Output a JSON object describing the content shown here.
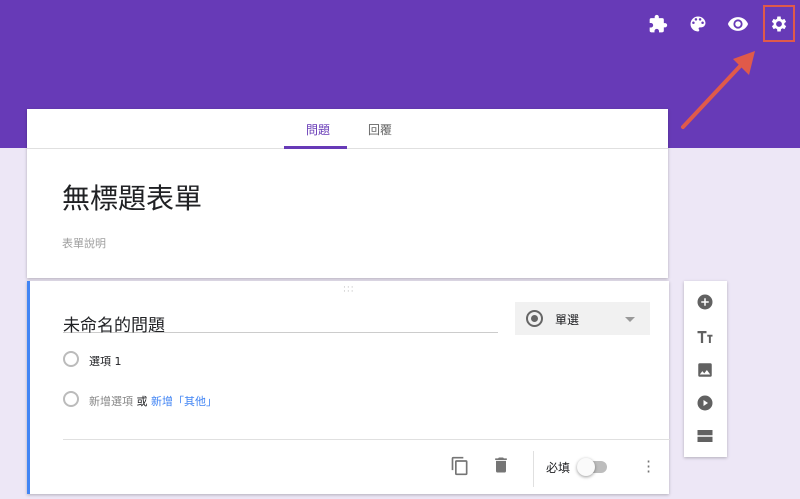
{
  "header": {
    "icons": [
      "puzzle-icon",
      "palette-icon",
      "eye-icon",
      "gear-icon"
    ],
    "color": "#673ab7"
  },
  "tabs": [
    {
      "label": "問題",
      "active": true
    },
    {
      "label": "回覆",
      "active": false
    }
  ],
  "form": {
    "title": "無標題表單",
    "description": "表單說明"
  },
  "question": {
    "title": "未命名的問題",
    "type": "單選",
    "options": [
      "選項 1"
    ],
    "add_option": "新增選項",
    "or": "或",
    "add_other": "新增「其他」",
    "required_label": "必填",
    "required": false
  },
  "side_toolbar": [
    "add-question-icon",
    "title-text-icon",
    "image-icon",
    "video-icon",
    "section-icon"
  ],
  "colors": {
    "accent": "#673ab7",
    "active_card": "#4285f4",
    "annotation": "#e05a4a"
  }
}
